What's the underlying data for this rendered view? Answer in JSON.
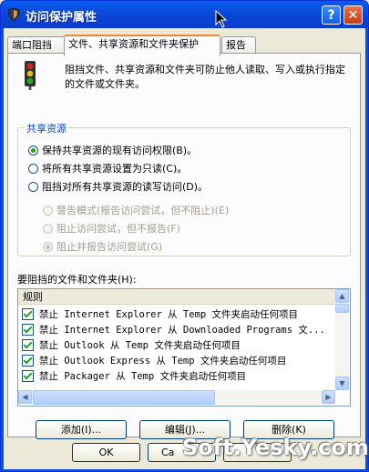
{
  "window": {
    "title": "访问保护属性",
    "help_label": "?",
    "close_label": "✕",
    "icon": "shield-icon"
  },
  "tabs": [
    {
      "label": "端口阻挡"
    },
    {
      "label": "文件、共享资源和文件夹保护"
    },
    {
      "label": "报告"
    }
  ],
  "panel": {
    "description": "阻挡文件、共享资源和文件夹可防止他人读取、写入或执行指定的文件或文件夹。",
    "share_group_label": "共享资源",
    "radios": [
      {
        "label": "保持共享资源的现有访问权限(B)。",
        "checked": true,
        "enabled": true
      },
      {
        "label": "将所有共享资源设置为只读(C)。",
        "checked": false,
        "enabled": true
      },
      {
        "label": "阻挡对所有共享资源的读写访问(D)。",
        "checked": false,
        "enabled": true
      },
      {
        "label": "警告模式(报告访问尝试，但不阻止)(E)",
        "checked": false,
        "enabled": false
      },
      {
        "label": "阻止访问尝试，但不报告(F)",
        "checked": false,
        "enabled": false
      },
      {
        "label": "阻止并报告访问尝试(G)",
        "checked": true,
        "enabled": false
      }
    ],
    "list_label": "要阻挡的文件和文件夹(H):",
    "list_header": "规则",
    "rules": [
      "禁止 Internet Explorer 从 Temp 文件夹启动任何项目",
      "禁止 Internet Explorer 从 Downloaded Programs 文...",
      "禁止 Outlook 从 Temp 文件夹启动任何项目",
      "禁止 Outlook Express 从 Temp 文件夹启动任何项目",
      "禁止 Packager 从 Temp 文件夹启动任何项目"
    ],
    "add_label": "添加(I)...",
    "edit_label": "编辑(J)...",
    "delete_label": "删除(K)"
  },
  "footer": {
    "ok_label": "OK",
    "cancel_label": "Ca"
  },
  "watermark": "Soft.Yesky.com",
  "colors": {
    "title_bar": "#0a46d6",
    "accent_tab": "#e68b2c",
    "check": "#21a121"
  }
}
